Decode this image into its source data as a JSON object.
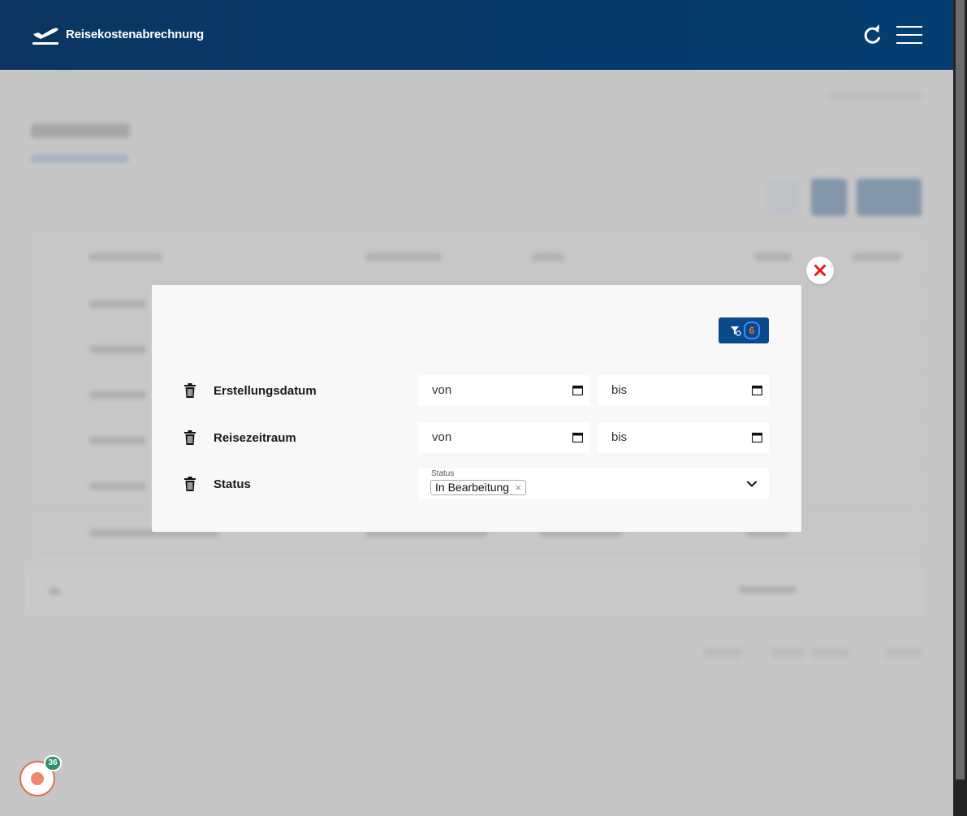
{
  "header": {
    "title": "Reisekostenabrechnung",
    "logo_icon": "airplane-takeoff-icon",
    "refresh_icon": "refresh-icon",
    "menu_icon": "hamburger-menu-icon"
  },
  "modal": {
    "filter_button": {
      "icon": "filter-remove-icon",
      "count": "6"
    },
    "rows": [
      {
        "label": "Erstellungsdatum",
        "from_placeholder": "von",
        "to_placeholder": "bis"
      },
      {
        "label": "Reisezeitraum",
        "from_placeholder": "von",
        "to_placeholder": "bis"
      }
    ],
    "status": {
      "label": "Status",
      "field_label": "Status",
      "selected": "In Bearbeitung",
      "remove_glyph": "×"
    }
  },
  "widget": {
    "badge_count": "36"
  },
  "colors": {
    "header_bg": "#06396b",
    "primary_button": "#0a4a8c",
    "badge_orange": "#f26a1b",
    "close_red": "#e21b1b",
    "badge_green": "#2f8f6a"
  }
}
